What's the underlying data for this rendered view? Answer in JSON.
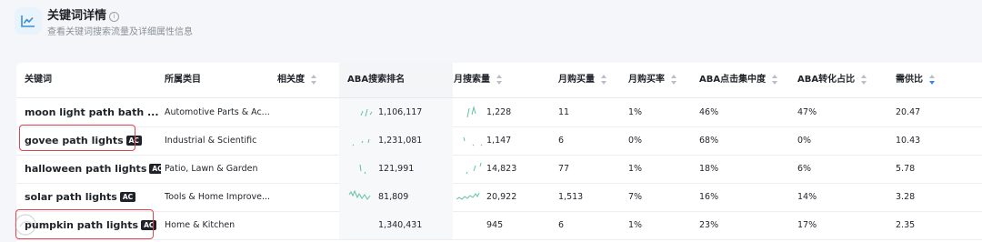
{
  "header": {
    "title": "关键词详情",
    "subtitle": "查看关键词搜索流量及详细属性信息"
  },
  "columns": [
    {
      "label": "关键词",
      "sortable": false
    },
    {
      "label": "所属类目",
      "sortable": false
    },
    {
      "label": "相关度",
      "sortable": true
    },
    {
      "label": "ABA搜索排名",
      "sortable": false
    },
    {
      "label": "月搜索量",
      "sortable": true
    },
    {
      "label": "月购买量",
      "sortable": true
    },
    {
      "label": "月购买率",
      "sortable": true
    },
    {
      "label": "ABA点击集中度",
      "sortable": true
    },
    {
      "label": "ABA转化占比",
      "sortable": true
    },
    {
      "label": "需供比",
      "sortable": true,
      "active_sort": "desc"
    }
  ],
  "badge_label": "AC",
  "rows": [
    {
      "keyword": "moon light path bath ...",
      "category": "Automotive Parts & Ac...",
      "relevance": "",
      "aba_rank": "1,106,117",
      "monthly_search": "1,228",
      "monthly_purchase": "11",
      "purchase_rate": "1%",
      "click_concentration": "46%",
      "conversion_share": "47%",
      "demand_supply": "20.47"
    },
    {
      "keyword": "govee path lights",
      "category": "Industrial & Scientific",
      "relevance": "",
      "aba_rank": "1,231,081",
      "monthly_search": "1,147",
      "monthly_purchase": "6",
      "purchase_rate": "0%",
      "click_concentration": "68%",
      "conversion_share": "0%",
      "demand_supply": "10.43"
    },
    {
      "keyword": "halloween path lights",
      "category": "Patio, Lawn & Garden",
      "relevance": "",
      "aba_rank": "121,991",
      "monthly_search": "14,823",
      "monthly_purchase": "77",
      "purchase_rate": "1%",
      "click_concentration": "18%",
      "conversion_share": "6%",
      "demand_supply": "5.78"
    },
    {
      "keyword": "solar path lights",
      "category": "Tools & Home Improve...",
      "relevance": "",
      "aba_rank": "81,809",
      "monthly_search": "20,922",
      "monthly_purchase": "1,513",
      "purchase_rate": "7%",
      "click_concentration": "16%",
      "conversion_share": "14%",
      "demand_supply": "3.28"
    },
    {
      "keyword": "pumpkin path lights",
      "category": "Home & Kitchen",
      "relevance": "",
      "aba_rank": "1,340,431",
      "monthly_search": "945",
      "monthly_purchase": "6",
      "purchase_rate": "1%",
      "click_concentration": "23%",
      "conversion_share": "17%",
      "demand_supply": "2.35"
    }
  ],
  "colors": {
    "spark": "#5fc39a",
    "highlight": "#e0454f",
    "sort_active": "#3b82f6"
  },
  "icons": {
    "header": "line-chart-icon",
    "info": "info-icon"
  }
}
